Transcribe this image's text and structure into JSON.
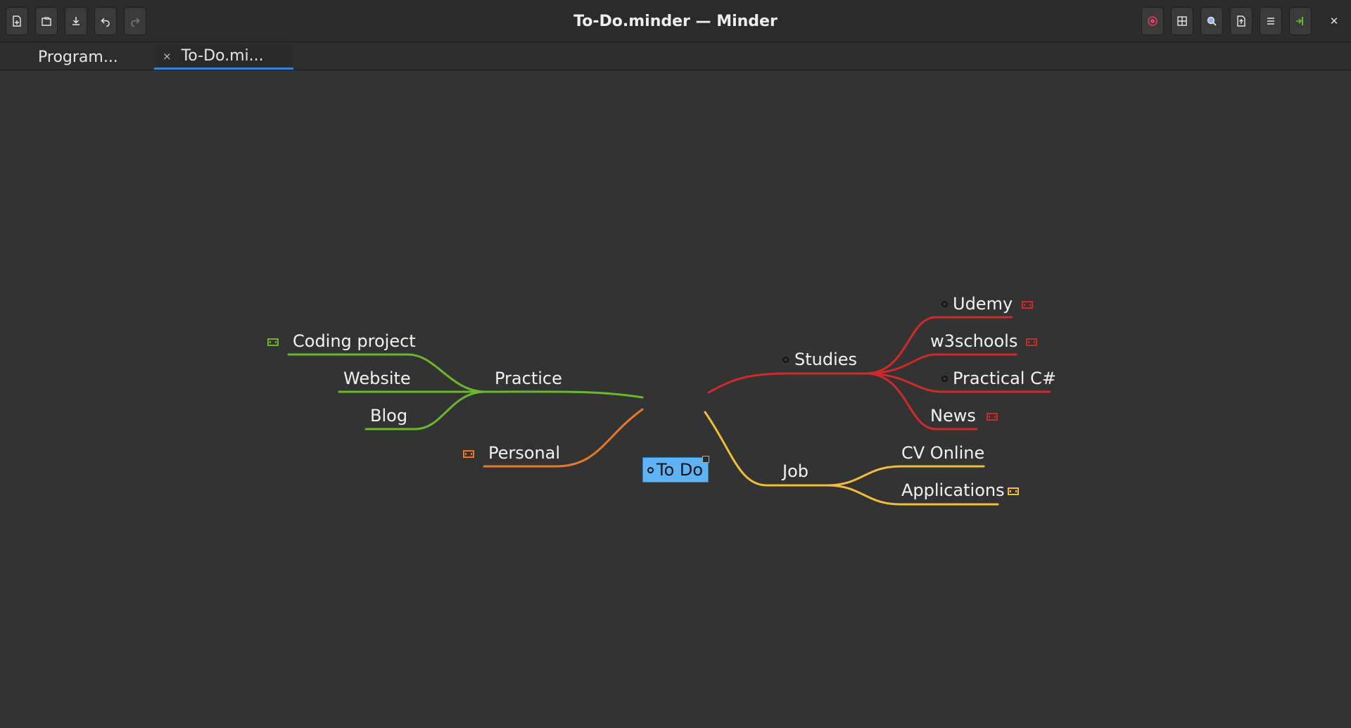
{
  "window": {
    "title": "To-Do.minder — Minder"
  },
  "toolbar": {
    "left_buttons": [
      "new-document-icon",
      "open-icon",
      "save-icon",
      "undo-icon",
      "redo-icon"
    ],
    "right_buttons": [
      "focus-mode-icon",
      "zoom-fit-icon",
      "search-icon",
      "export-icon",
      "menu-icon",
      "sidebar-icon"
    ]
  },
  "tabs": [
    {
      "label": "Program..."
    },
    {
      "label": "To-Do.mi...",
      "close": "×"
    }
  ],
  "mindmap": {
    "root": {
      "label": "To Do",
      "color": "#5db3f5"
    },
    "branches": {
      "practice": {
        "label": "Practice",
        "color": "#6ab82e",
        "children": {
          "coding": "Coding project",
          "website": "Website",
          "blog": "Blog"
        }
      },
      "personal": {
        "label": "Personal",
        "color": "#e8782a"
      },
      "studies": {
        "label": "Studies",
        "color": "#cf2a2a",
        "children": {
          "udemy": "Udemy",
          "w3schools": "w3schools",
          "practical": "Practical C#",
          "news": "News"
        }
      },
      "job": {
        "label": "Job",
        "color": "#f2be3a",
        "children": {
          "cv": "CV Online",
          "applications": "Applications"
        }
      }
    }
  }
}
